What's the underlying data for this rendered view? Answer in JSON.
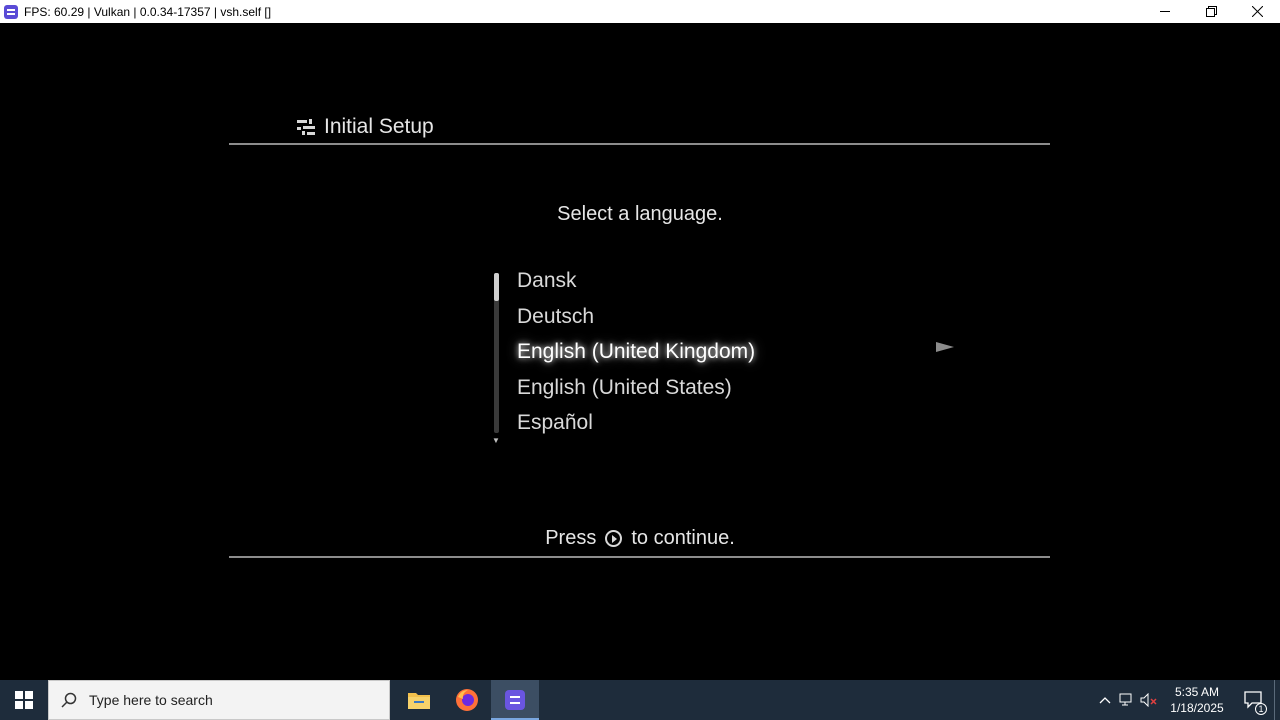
{
  "window": {
    "title": "FPS: 60.29 | Vulkan | 0.0.34-17357 | vsh.self []",
    "minimize_glyph": "—",
    "restore_glyph": "❐",
    "close_glyph": "✕"
  },
  "setup": {
    "title": "Initial Setup",
    "prompt": "Select a language.",
    "languages": [
      "Dansk",
      "Deutsch",
      "English (United Kingdom)",
      "English (United States)",
      "Español"
    ],
    "selected_index": 2,
    "continue_before": "Press",
    "continue_after": "to continue."
  },
  "taskbar": {
    "search_placeholder": "Type here to search",
    "apps": [
      "file-explorer-icon",
      "firefox-icon",
      "rpcs3-icon"
    ],
    "active_app": "rpcs3-icon",
    "time": "5:35 AM",
    "date": "1/18/2025",
    "notification_count": "1"
  },
  "colors": {
    "taskbar_bg": "#1e2c3b",
    "accent": "#5a4bd6"
  }
}
